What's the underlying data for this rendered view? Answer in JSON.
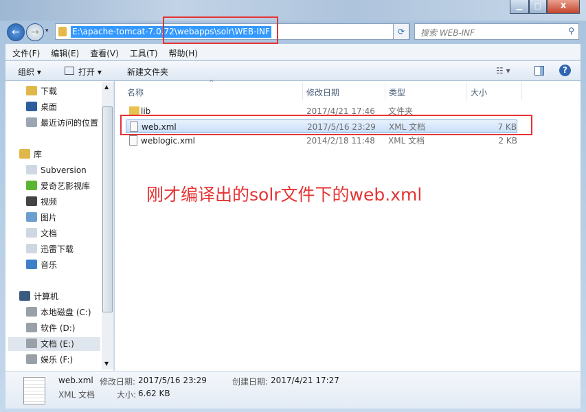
{
  "window": {
    "minimize": "▁",
    "maximize": "□",
    "close": "X"
  },
  "address": {
    "path": "E:\\apache-tomcat-7.0.72\\webapps\\solr\\WEB-INF",
    "search_placeholder": "搜索 WEB-INF"
  },
  "menu": [
    "文件(F)",
    "编辑(E)",
    "查看(V)",
    "工具(T)",
    "帮助(H)"
  ],
  "toolbar": {
    "organize": "组织 ▾",
    "open": "打开 ▾",
    "new_folder": "新建文件夹"
  },
  "nav": [
    {
      "label": "下载",
      "icon": "download-folder-icon",
      "color": "#e0b84a"
    },
    {
      "label": "桌面",
      "icon": "desktop-icon",
      "color": "#2c5e9e"
    },
    {
      "label": "最近访问的位置",
      "icon": "recent-places-icon",
      "color": "#9aa7b3"
    },
    {
      "label": "库",
      "icon": "library-icon",
      "color": "#e0b84a"
    },
    {
      "label": "Subversion",
      "icon": "library-doc-icon",
      "color": "#cfd8e2"
    },
    {
      "label": "爱奇艺影视库",
      "icon": "iqiyi-icon",
      "color": "#5cb531"
    },
    {
      "label": "视频",
      "icon": "video-icon",
      "color": "#444"
    },
    {
      "label": "图片",
      "icon": "pictures-icon",
      "color": "#6a9fd0"
    },
    {
      "label": "文档",
      "icon": "documents-icon",
      "color": "#cfd8e2"
    },
    {
      "label": "迅雷下载",
      "icon": "library-doc-icon",
      "color": "#cfd8e2"
    },
    {
      "label": "音乐",
      "icon": "music-icon",
      "color": "#3f7fc9"
    },
    {
      "label": "计算机",
      "icon": "computer-icon",
      "color": "#3a5a80"
    },
    {
      "label": "本地磁盘 (C:)",
      "icon": "drive-icon",
      "color": "#9aa0a8"
    },
    {
      "label": "软件 (D:)",
      "icon": "drive-icon",
      "color": "#9aa0a8"
    },
    {
      "label": "文档 (E:)",
      "icon": "drive-icon",
      "color": "#9aa0a8"
    },
    {
      "label": "娱乐 (F:)",
      "icon": "drive-icon",
      "color": "#9aa0a8"
    }
  ],
  "columns": {
    "name": "名称",
    "modified": "修改日期",
    "type": "类型",
    "size": "大小"
  },
  "files": [
    {
      "name": "lib",
      "modified": "2017/4/21 17:46",
      "type": "文件夹",
      "size": ""
    },
    {
      "name": "web.xml",
      "modified": "2017/5/16 23:29",
      "type": "XML 文档",
      "size": "7 KB"
    },
    {
      "name": "weblogic.xml",
      "modified": "2014/2/18 11:48",
      "type": "XML 文档",
      "size": "2 KB"
    }
  ],
  "annotation": "刚才编译出的solr文件下的web.xml",
  "details": {
    "name": "web.xml",
    "type": "XML 文档",
    "modified_label": "修改日期:",
    "modified": "2017/5/16 23:29",
    "created_label": "创建日期:",
    "created": "2017/4/21 17:27",
    "size_label": "大小:",
    "size": "6.62 KB"
  },
  "colors": {
    "selection": "#3399ff",
    "annotation": "#e53333"
  }
}
